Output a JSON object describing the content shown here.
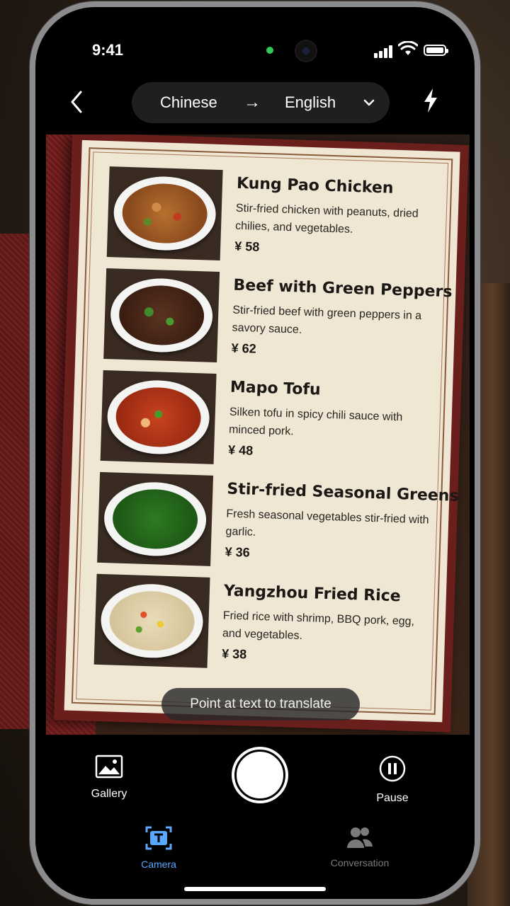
{
  "status_bar": {
    "time": "9:41"
  },
  "top_bar": {
    "source_language": "Chinese",
    "arrow": "→",
    "target_language": "English"
  },
  "menu": {
    "items": [
      {
        "name": "Kung Pao Chicken",
        "description": "Stir-fried chicken with peanuts, dried chilies, and vegetables.",
        "price": "¥ 58"
      },
      {
        "name": "Beef with Green Peppers",
        "description": "Stir-fried beef with green peppers in a savory sauce.",
        "price": "¥ 62"
      },
      {
        "name": "Mapo Tofu",
        "description": "Silken tofu in spicy chili sauce with minced pork.",
        "price": "¥ 48"
      },
      {
        "name": "Stir-fried Seasonal Greens",
        "description": "Fresh seasonal vegetables stir-fried with garlic.",
        "price": "¥ 36"
      },
      {
        "name": "Yangzhou Fried Rice",
        "description": "Fried rice with shrimp, BBQ pork, egg, and vegetables.",
        "price": "¥ 38"
      }
    ]
  },
  "hint": "Point at text to translate",
  "controls": {
    "gallery_label": "Gallery",
    "pause_label": "Pause"
  },
  "tabs": {
    "camera_label": "Camera",
    "conversation_label": "Conversation"
  },
  "colors": {
    "accent": "#5aa7ff",
    "recording_dot": "#34c759",
    "menu_paper": "#efe6d3",
    "menu_frame": "#6b1f1c"
  },
  "icons": [
    "back-chevron-icon",
    "arrow-right-icon",
    "chevron-down-icon",
    "flash-icon",
    "gallery-icon",
    "pause-icon",
    "camera-translate-icon",
    "conversation-icon"
  ]
}
